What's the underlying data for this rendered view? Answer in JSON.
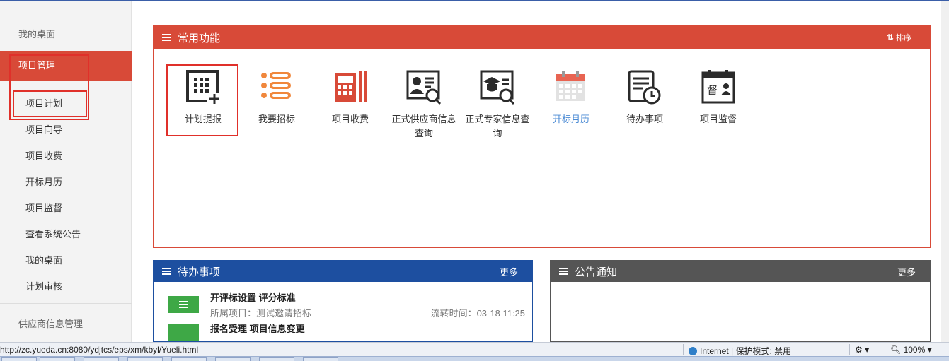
{
  "sidebar": {
    "group1": "我的桌面",
    "active": "项目管理",
    "items": [
      "项目计划",
      "项目向导",
      "项目收费",
      "开标月历",
      "项目监督",
      "查看系统公告",
      "我的桌面",
      "计划审核"
    ],
    "group2": "供应商信息管理"
  },
  "common": {
    "title": "常用功能",
    "sort_label": "排序",
    "sort_icon": "sort-arrows-icon",
    "functions": [
      {
        "label": "计划提报",
        "icon": "plan-submit-icon"
      },
      {
        "label": "我要招标",
        "icon": "bid-list-icon"
      },
      {
        "label": "项目收费",
        "icon": "cashier-icon"
      },
      {
        "label": "正式供应商信息查询",
        "icon": "supplier-search-icon"
      },
      {
        "label": "正式专家信息查询",
        "icon": "expert-search-icon"
      },
      {
        "label": "开标月历",
        "icon": "calendar-icon"
      },
      {
        "label": "待办事项",
        "icon": "todo-clock-icon"
      },
      {
        "label": "项目监督",
        "icon": "supervise-icon"
      }
    ]
  },
  "todo": {
    "title": "待办事项",
    "more": "更多",
    "rows": [
      {
        "title": "开评标设置  评分标准",
        "project": "所属项目：测试邀请招标",
        "time": "流转时间：03-18 11:25"
      },
      {
        "title": "报名受理  项目信息变更"
      }
    ]
  },
  "notice": {
    "title": "公告通知",
    "more": "更多"
  },
  "status": {
    "url": "http://zc.yueda.cn:8080/ydjtcs/eps/xm/kbyl/Yueli.html",
    "zone": "Internet | 保护模式: 禁用",
    "zoom": "100%"
  },
  "colors": {
    "accent": "#d84a38",
    "todo": "#1d4fa0",
    "notice": "#555555",
    "badge": "#3ea846",
    "link": "#4a8ad4"
  }
}
